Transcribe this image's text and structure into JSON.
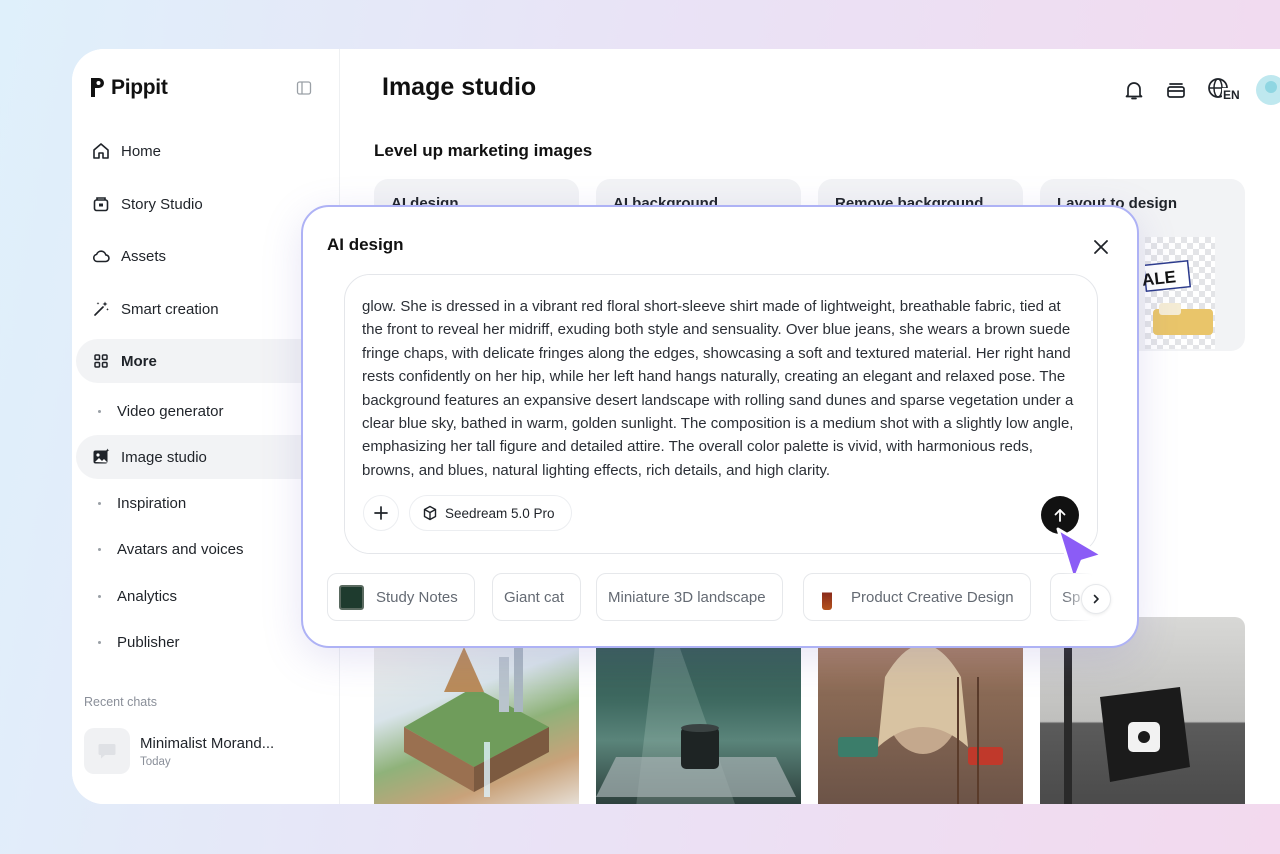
{
  "brand": {
    "name": "Pippit"
  },
  "sidebar": {
    "items": [
      {
        "label": "Home",
        "icon": "home-icon"
      },
      {
        "label": "Story Studio",
        "icon": "story-icon"
      },
      {
        "label": "Assets",
        "icon": "cloud-icon"
      },
      {
        "label": "Smart creation",
        "icon": "magic-wand-icon"
      },
      {
        "label": "More",
        "icon": "grid-icon"
      }
    ],
    "sub_items": [
      {
        "label": "Video generator"
      },
      {
        "label": "Image studio",
        "active": true
      },
      {
        "label": "Inspiration"
      },
      {
        "label": "Avatars and voices"
      },
      {
        "label": "Analytics"
      },
      {
        "label": "Publisher"
      }
    ],
    "recent_title": "Recent chats",
    "recent_chats": [
      {
        "title": "Minimalist Morand...",
        "time": "Today"
      }
    ]
  },
  "header": {
    "title": "Image studio",
    "language_badge": "EN"
  },
  "main": {
    "section_title": "Level up marketing images",
    "feature_cards": [
      {
        "label": "AI design"
      },
      {
        "label": "AI background"
      },
      {
        "label": "Remove background"
      },
      {
        "label": "Layout to design"
      }
    ],
    "sale_badge": "ALE"
  },
  "modal": {
    "title": "AI design",
    "prompt": "glow. She is dressed in a vibrant red floral short-sleeve shirt made of lightweight, breathable fabric, tied at the front to reveal her midriff, exuding both style and sensuality. Over blue jeans, she wears a brown suede fringe chaps, with delicate fringes along the edges, showcasing a soft and textured material. Her right hand rests confidently on her hip, while her left hand hangs naturally, creating an elegant and relaxed pose. The background features an expansive desert landscape with rolling sand dunes and sparse vegetation under a clear blue sky, bathed in warm, golden sunlight. The composition is a medium shot with a slightly low angle, emphasizing her tall figure and detailed attire. The overall color palette is vivid, with harmonious reds, browns, and blues, natural lighting effects, rich details, and high clarity.",
    "model": "Seedream 5.0 Pro",
    "chips": [
      {
        "label": "Study Notes"
      },
      {
        "label": "Giant cat"
      },
      {
        "label": "Miniature 3D landscape"
      },
      {
        "label": "Product Creative Design"
      },
      {
        "label": "Sp"
      }
    ]
  },
  "colors": {
    "accent_border": "#aeb2f5",
    "cursor": "#8b5cf6",
    "send_button": "#111111"
  }
}
